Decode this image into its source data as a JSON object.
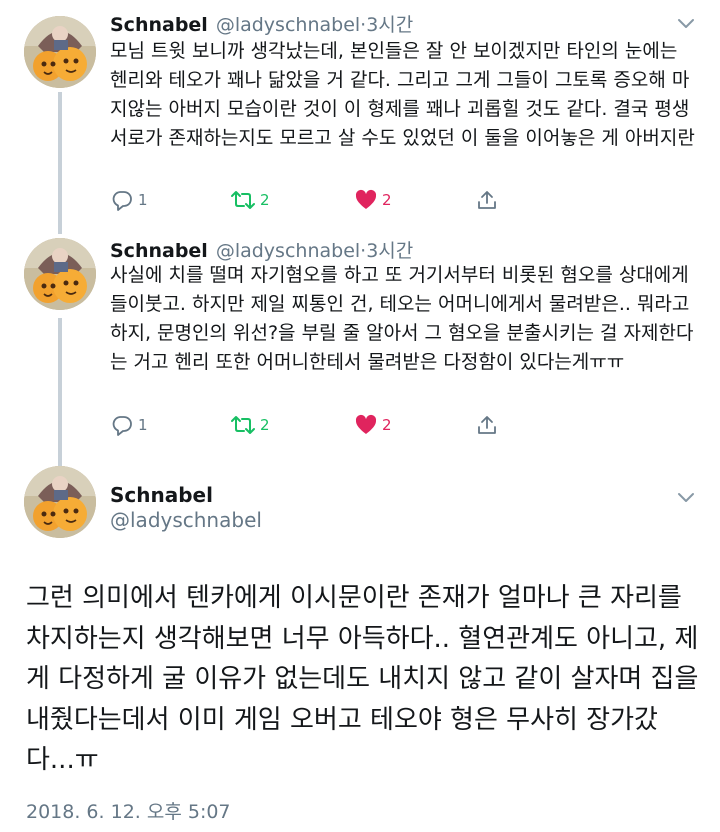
{
  "tweets": [
    {
      "name": "Schnabel",
      "handle": "@ladyschnabel",
      "time": "·3시간",
      "text": "모님 트윗 보니까 생각났는데, 본인들은 잘 안 보이겠지만 타인의 눈에는 헨리와 테오가 꽤나 닮았을 거 같다. 그리고 그게 그들이 그토록 증오해 마지않는 아버지 모습이란 것이 이 형제를 꽤나 괴롭힐 것도 같다. 결국 평생 서로가 존재하는지도 모르고 살 수도 있었던 이 둘을 이어놓은 게 아버지란",
      "replies": "1",
      "retweets": "2",
      "likes": "2"
    },
    {
      "name": "Schnabel",
      "handle": "@ladyschnabel",
      "time": "·3시간",
      "text": "사실에 치를 떨며 자기혐오를 하고 또 거기서부터 비롯된 혐오를 상대에게 들이붓고. 하지만 제일 찌통인 건, 테오는 어머니에게서 물려받은.. 뭐라고 하지, 문명인의 위선?을 부릴 줄 알아서 그 혐오을 분출시키는 걸 자제한다는 거고 헨리 또한 어머니한테서 물려받은 다정함이 있다는게ㅠㅠ",
      "replies": "1",
      "retweets": "2",
      "likes": "2"
    }
  ],
  "focal": {
    "name": "Schnabel",
    "handle": "@ladyschnabel",
    "text": "그런 의미에서 텐카에게 이시문이란 존재가 얼마나 큰 자리를 차지하는지 생각해보면 너무 아득하다.. 혈연관계도 아니고, 제게 다정하게 굴 이유가 없는데도 내치지 않고 같이 살자며 집을 내줬다는데서 이미 게임 오버고 테오야 형은 무사히 장가갔다...ㅠ",
    "date": "2018. 6. 12. 오후 5:07"
  },
  "colors": {
    "text": "#14171a",
    "secondary": "#657786",
    "retweet": "#17bf63",
    "like": "#e0245e",
    "thread_line": "#c7d0d8"
  },
  "icons": [
    "avatar",
    "chevron-down-icon",
    "reply-icon",
    "retweet-icon",
    "heart-icon",
    "share-icon"
  ]
}
